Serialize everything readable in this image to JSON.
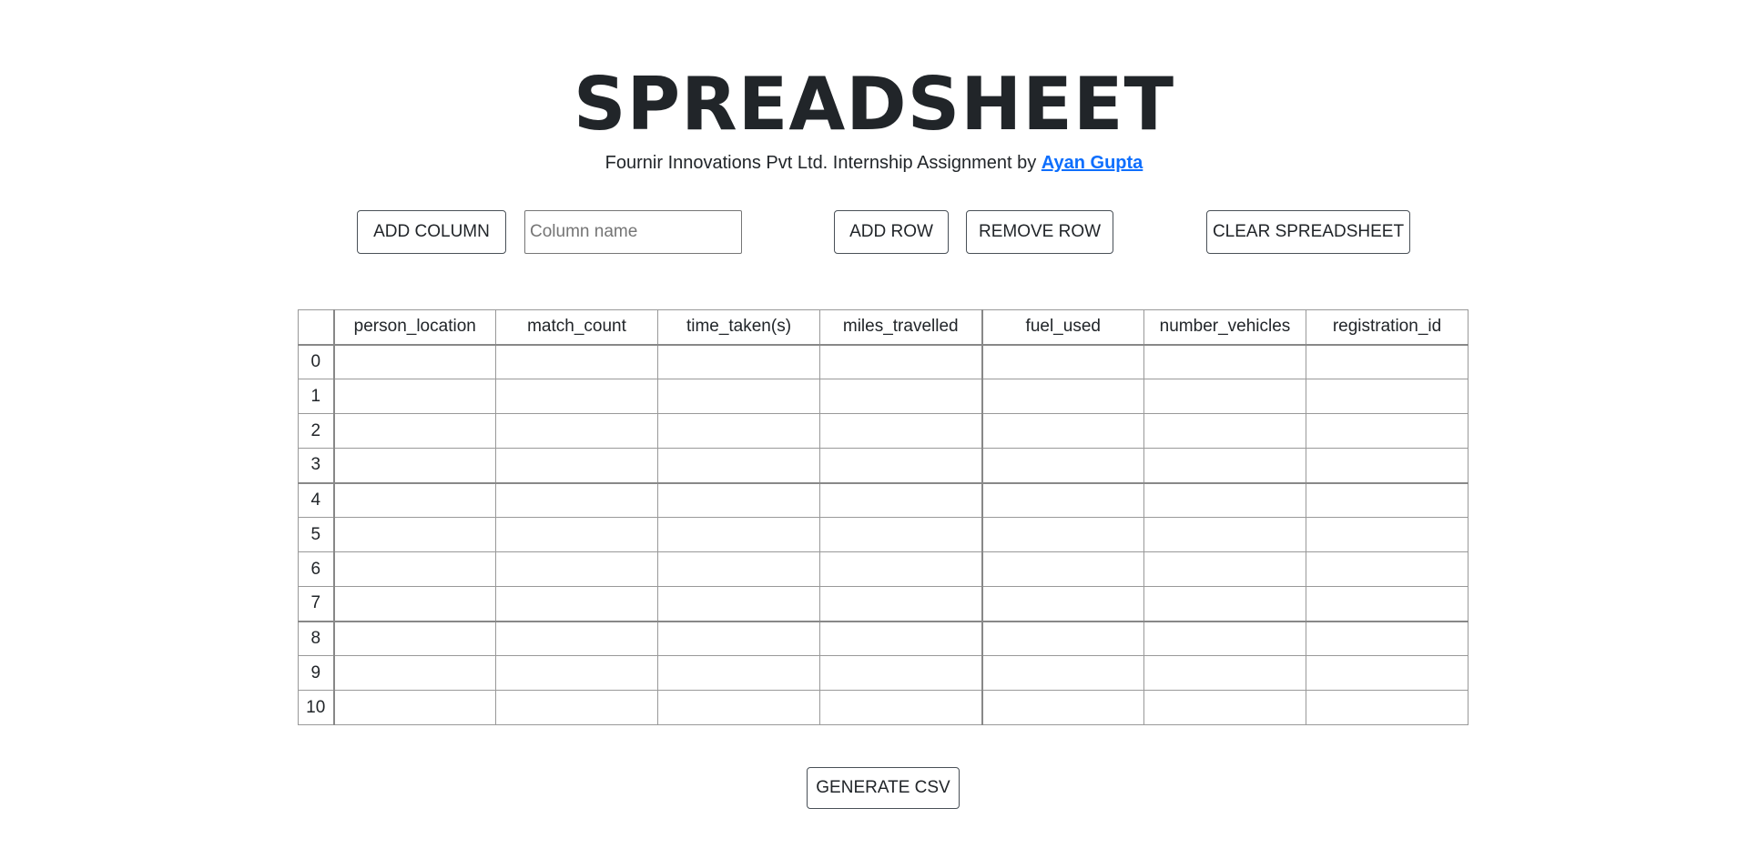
{
  "header": {
    "title": "SPREADSHEET",
    "subtitle_prefix": "Fournir Innovations Pvt Ltd. Internship Assignment by ",
    "author_link": "Ayan Gupta"
  },
  "toolbar": {
    "add_column_label": "ADD COLUMN",
    "column_name_placeholder": "Column name",
    "column_name_value": "",
    "add_row_label": "ADD ROW",
    "remove_row_label": "REMOVE ROW",
    "clear_label": "CLEAR SPREADSHEET"
  },
  "table": {
    "columns": [
      "person_location",
      "match_count",
      "time_taken(s)",
      "miles_travelled",
      "fuel_used",
      "number_vehicles",
      "registration_id"
    ],
    "rows": [
      "0",
      "1",
      "2",
      "3",
      "4",
      "5",
      "6",
      "7",
      "8",
      "9",
      "10"
    ]
  },
  "footer": {
    "generate_csv_label": "GENERATE CSV"
  },
  "colors": {
    "text": "#212529",
    "link": "#0d6efd",
    "border": "#999999"
  }
}
